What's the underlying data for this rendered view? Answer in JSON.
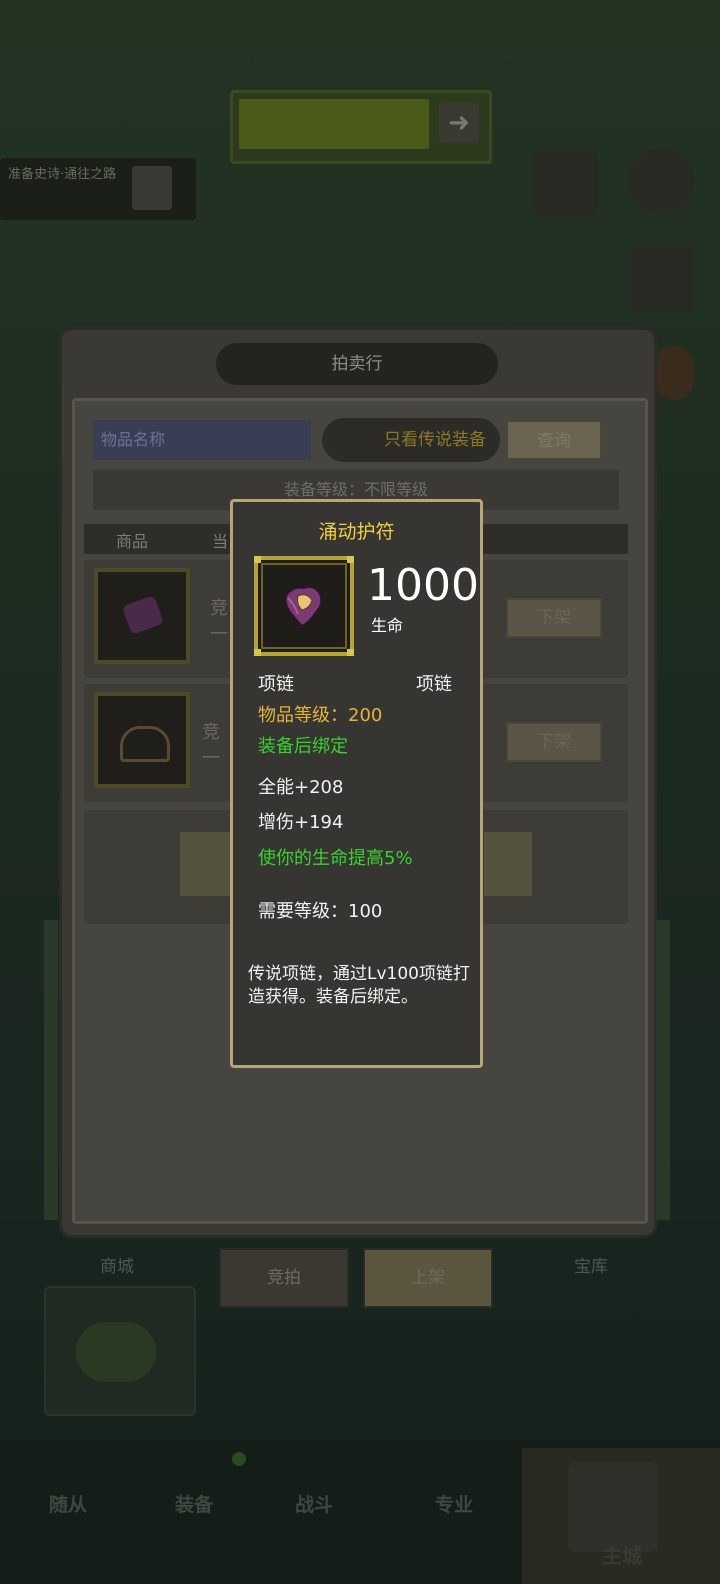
{
  "background": {
    "quest_text": "准备史诗·通往之路",
    "auction_title": "拍卖行",
    "search_placeholder": "物品名称",
    "legend_toggle": "只看传说装备",
    "query_button": "查询",
    "level_filter": "装备等级：不限等级",
    "columns": [
      "商品",
      "当"
    ],
    "rows": [
      {
        "text": "竞",
        "sub": "一",
        "delist": "下架"
      },
      {
        "text": "竞",
        "sub": "一",
        "delist": "下架"
      }
    ],
    "tabs": {
      "auction": "竞拍",
      "list": "上架"
    },
    "side_labels": {
      "shop": "商城",
      "vault": "宝库"
    },
    "nav": [
      "随从",
      "装备",
      "战斗",
      "专业",
      "主城"
    ]
  },
  "tooltip": {
    "name": "涌动护符",
    "value": "1000",
    "value_label": "生命",
    "slot_left": "项链",
    "slot_right": "项链",
    "item_level": "物品等级：200",
    "bind": "装备后绑定",
    "stat1": "全能+208",
    "stat2": "增伤+194",
    "effect": "使你的生命提高5%",
    "req_level": "需要等级：100",
    "description": "传说项链，通过Lv100项链打造获得。装备后绑定。"
  },
  "colors": {
    "name": "#f0cf43",
    "item_level": "#e3b43a",
    "green": "#39d130",
    "border": "#b9a676"
  }
}
